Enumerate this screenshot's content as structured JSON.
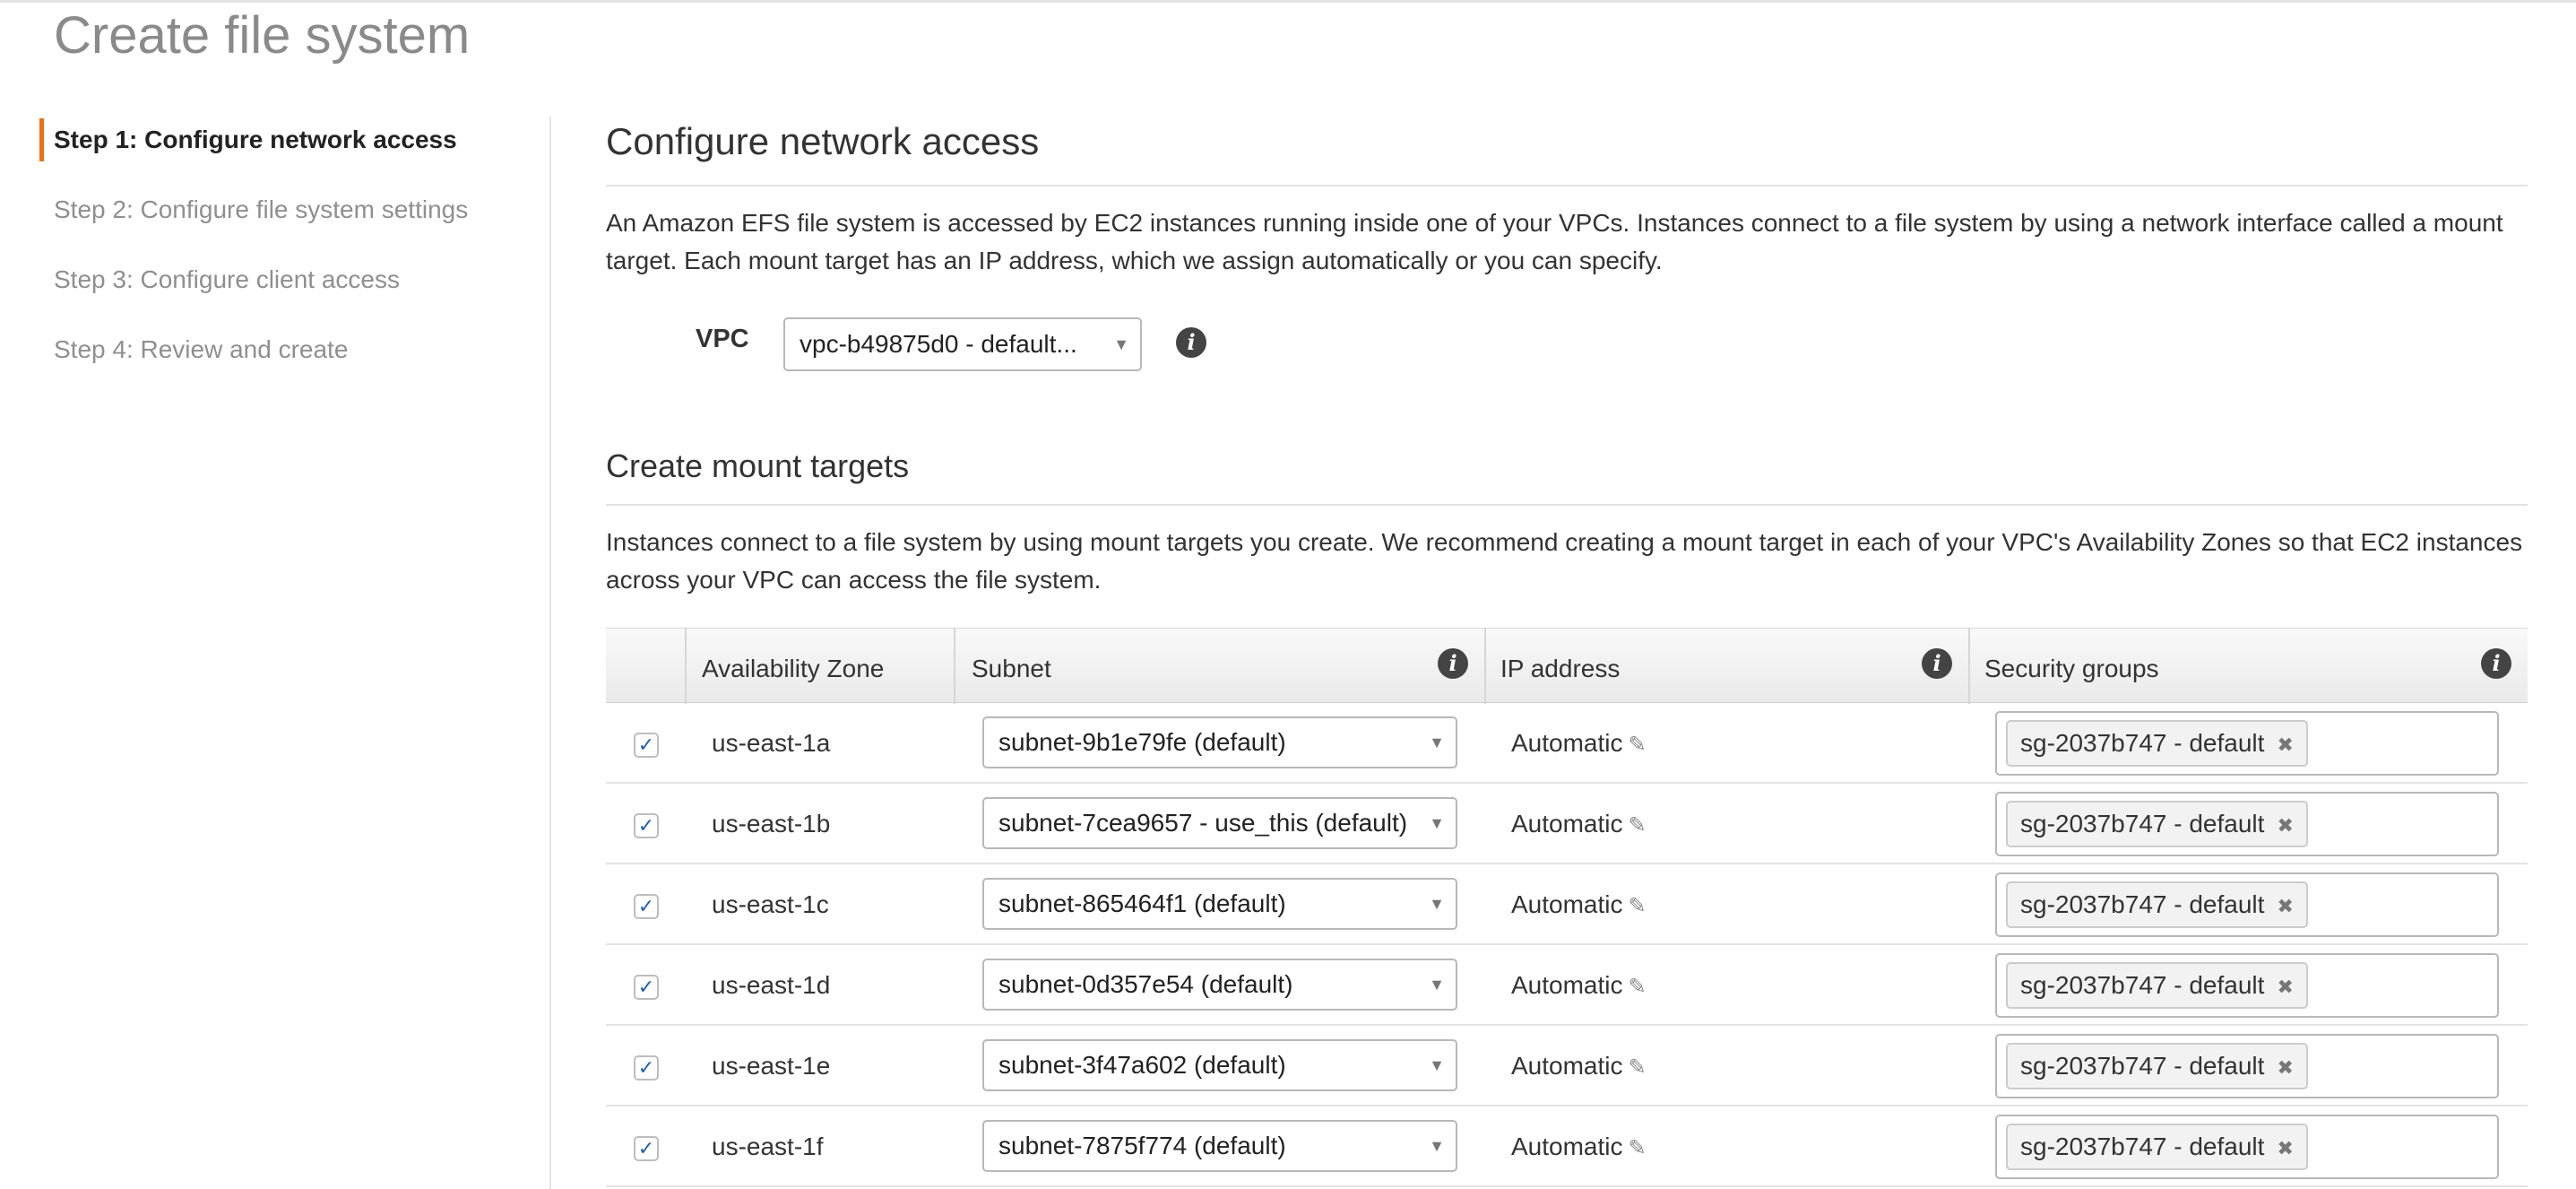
{
  "page": {
    "title": "Create file system"
  },
  "steps": [
    {
      "label": "Step 1: Configure network access",
      "active": true
    },
    {
      "label": "Step 2: Configure file system settings",
      "active": false
    },
    {
      "label": "Step 3: Configure client access",
      "active": false
    },
    {
      "label": "Step 4: Review and create",
      "active": false
    }
  ],
  "network": {
    "title": "Configure network access",
    "description": "An Amazon EFS file system is accessed by EC2 instances running inside one of your VPCs. Instances connect to a file system by using a network interface called a mount target. Each mount target has an IP address, which we assign automatically or you can specify.",
    "vpc_label": "VPC",
    "vpc_value": "vpc-b49875d0 - default..."
  },
  "mount": {
    "title": "Create mount targets",
    "description": "Instances connect to a file system by using mount targets you create. We recommend creating a mount target in each of your VPC's Availability Zones so that EC2 instances across your VPC can access the file system."
  },
  "table": {
    "headers": {
      "az": "Availability Zone",
      "subnet": "Subnet",
      "ip": "IP address",
      "sg": "Security groups"
    },
    "rows": [
      {
        "checked": true,
        "az": "us-east-1a",
        "subnet": "subnet-9b1e79fe (default)",
        "ip": "Automatic",
        "sg": "sg-2037b747 - default"
      },
      {
        "checked": true,
        "az": "us-east-1b",
        "subnet": "subnet-7cea9657 - use_this (default)",
        "ip": "Automatic",
        "sg": "sg-2037b747 - default"
      },
      {
        "checked": true,
        "az": "us-east-1c",
        "subnet": "subnet-865464f1 (default)",
        "ip": "Automatic",
        "sg": "sg-2037b747 - default"
      },
      {
        "checked": true,
        "az": "us-east-1d",
        "subnet": "subnet-0d357e54 (default)",
        "ip": "Automatic",
        "sg": "sg-2037b747 - default"
      },
      {
        "checked": true,
        "az": "us-east-1e",
        "subnet": "subnet-3f47a602 (default)",
        "ip": "Automatic",
        "sg": "sg-2037b747 - default"
      },
      {
        "checked": true,
        "az": "us-east-1f",
        "subnet": "subnet-7875f774 (default)",
        "ip": "Automatic",
        "sg": "sg-2037b747 - default"
      }
    ]
  },
  "icons": {
    "info": "info-icon",
    "dropdown": "chevron-down-icon",
    "edit": "pencil-icon",
    "remove": "close-icon",
    "check": "checkmark-icon"
  },
  "colors": {
    "active_step_accent": "#ec7211",
    "checkbox_check": "#1f5fb7"
  }
}
